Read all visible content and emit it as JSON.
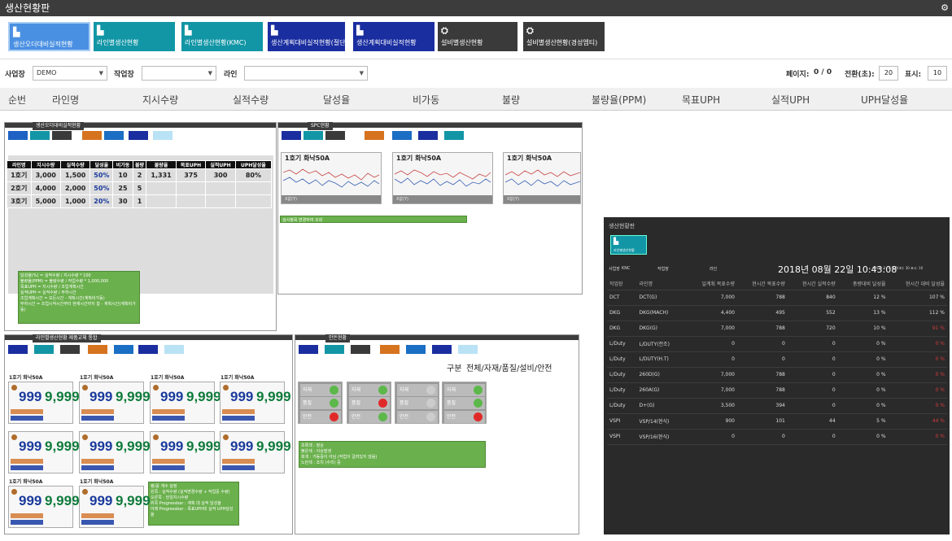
{
  "app": {
    "title": "생산현황판"
  },
  "menu": [
    {
      "label": "생산오더대비실적현황",
      "color": "#1f62c4"
    },
    {
      "label": "라인별생산현황",
      "color": "#1296a6"
    },
    {
      "label": "라인별생산현황(KMC)",
      "color": "#1296a6"
    },
    {
      "label": "생산계획대비실적현황(절단",
      "color": "#1a2ea0"
    },
    {
      "label": "생산계획대비실적현황",
      "color": "#1a2ea0"
    },
    {
      "label": "설비별생산현황",
      "color": "#3a3a3a"
    },
    {
      "label": "설비별생산현황(경성엠티)",
      "color": "#3a3a3a"
    }
  ],
  "filters": {
    "site_label": "사업장",
    "site_value": "DEMO",
    "workplace_label": "작업장",
    "workplace_value": "",
    "line_label": "라인",
    "line_value": "",
    "page_label": "페이지:",
    "page_value": "0  /  0",
    "switch_label": "전환(초):",
    "switch_value": "20",
    "display_label": "표시:",
    "display_value": "10"
  },
  "columns": [
    "순번",
    "라인명",
    "지시수량",
    "실적수량",
    "달성율",
    "비가동",
    "불량",
    "불량율(PPM)",
    "목표UPH",
    "실적UPH",
    "UPH달성율"
  ],
  "thumbs": {
    "t1": {
      "caption": "생산오더대비실적현황",
      "header": [
        "라인명",
        "지시수량",
        "실적수량",
        "달성율",
        "비가동",
        "불량",
        "불량율",
        "목표UPH",
        "실적UPH",
        "UPH달성율"
      ],
      "rows": [
        [
          "1호기",
          "3,000",
          "1,500",
          "50%",
          "10",
          "2",
          "1,331",
          "375",
          "300",
          "80%"
        ],
        [
          "2호기",
          "4,000",
          "2,000",
          "50%",
          "25",
          "5",
          "",
          "",
          "",
          ""
        ],
        [
          "3호기",
          "5,000",
          "1,000",
          "20%",
          "30",
          "1",
          "",
          "",
          "",
          ""
        ]
      ],
      "note": [
        "달성율(%) = 실적수량 / 지시수량 * 100",
        "불량율(PPM) = 불량수량 / 작업수량 * 1,000,000",
        "목표UPH = 지시수량 / 조업계획시간",
        "실적UPH = 실적수량 / 부하시간",
        "",
        "조업계획시간 = 모든시간 - 계획시간(계획비가동)",
        "부하시간 = 조업시작시간부터 현재시간까지 합 - 계획시간(계획비가동)"
      ]
    },
    "t2": {
      "caption": "SPC현황",
      "charts": [
        {
          "title": "1호기 화낙50A",
          "foot": "X값(Y)"
        },
        {
          "title": "1호기 화낙50A",
          "foot": "X값(Y)"
        },
        {
          "title": "1호기 화낙50A",
          "foot": "X값(Y)"
        }
      ],
      "note": "검사항목 변경하여 조회"
    },
    "t3": {
      "caption": "라인별생산현황 제품교체 통합",
      "card_title": "1호기 화낙50A",
      "v1": "999",
      "v2": "9,999",
      "note": [
        "랭/꽁 개수 설정",
        "",
        "왼쪽 : 실적수량 (실적변경수량 + 작업중 수량)",
        "오른쪽 : 당일지시수량",
        "위쪽 Progressbar : 계획 대 실적 달성율",
        "아래 Progressbar : 목표UPH대 실적 UPH달성율"
      ]
    },
    "t4": {
      "caption": "안돈현황",
      "heading_label": "구분",
      "heading_value": "전체/자재/품질/설비/안전",
      "box_title": "1호기 화낙50A",
      "rows": [
        "자재",
        "품질",
        "안전"
      ],
      "note": [
        "초록색 : 정상",
        "붉은색 : 이상발생",
        "회색 : 가동중이 아님 (작업이 걸려있지 않음)",
        "노란색 : 조치 (수리) 중"
      ]
    },
    "t5": {
      "caption": "생산현황판",
      "menu_label": "라인별생산현황",
      "date": "2018년 08월 22일 10:43:08",
      "filter_labels": [
        "사업장",
        "작업장",
        "라인"
      ],
      "filter_site": "KNC",
      "page": "페이지:  2  /  6  전환(초):  30  표시:  10",
      "header": [
        "작업장",
        "라인명",
        "일계획 목표수량",
        "현시간 목표수량",
        "현시간 실적수량",
        "총량대비 달성율",
        "현시간 대비 달성율"
      ],
      "rows": [
        [
          "DCT",
          "DCT(G)",
          "7,000",
          "788",
          "840",
          "12 %",
          "107 %"
        ],
        [
          "DKG",
          "DKG(MACH)",
          "4,400",
          "495",
          "552",
          "13 %",
          "112 %"
        ],
        [
          "DKG",
          "DKG(G)",
          "7,000",
          "788",
          "720",
          "10 %",
          "91 %"
        ],
        [
          "L/Duty",
          "L/DUTY(전조)",
          "0",
          "0",
          "0",
          "0 %",
          "0 %"
        ],
        [
          "L/Duty",
          "L/DUTY(H.T)",
          "0",
          "0",
          "0",
          "0 %",
          "0 %"
        ],
        [
          "L/Duty",
          "260D(G)",
          "7,000",
          "788",
          "0",
          "0 %",
          "0 %"
        ],
        [
          "L/Duty",
          "260A(G)",
          "7,000",
          "788",
          "0",
          "0 %",
          "0 %"
        ],
        [
          "L/Duty",
          "D+(G)",
          "3,500",
          "394",
          "0",
          "0 %",
          "0 %"
        ],
        [
          "VSPI",
          "VSP/14(현식)",
          "900",
          "101",
          "44",
          "5 %",
          "44 %"
        ],
        [
          "VSPI",
          "VSP/16(현식)",
          "0",
          "0",
          "0",
          "0 %",
          "0 %"
        ]
      ]
    }
  }
}
